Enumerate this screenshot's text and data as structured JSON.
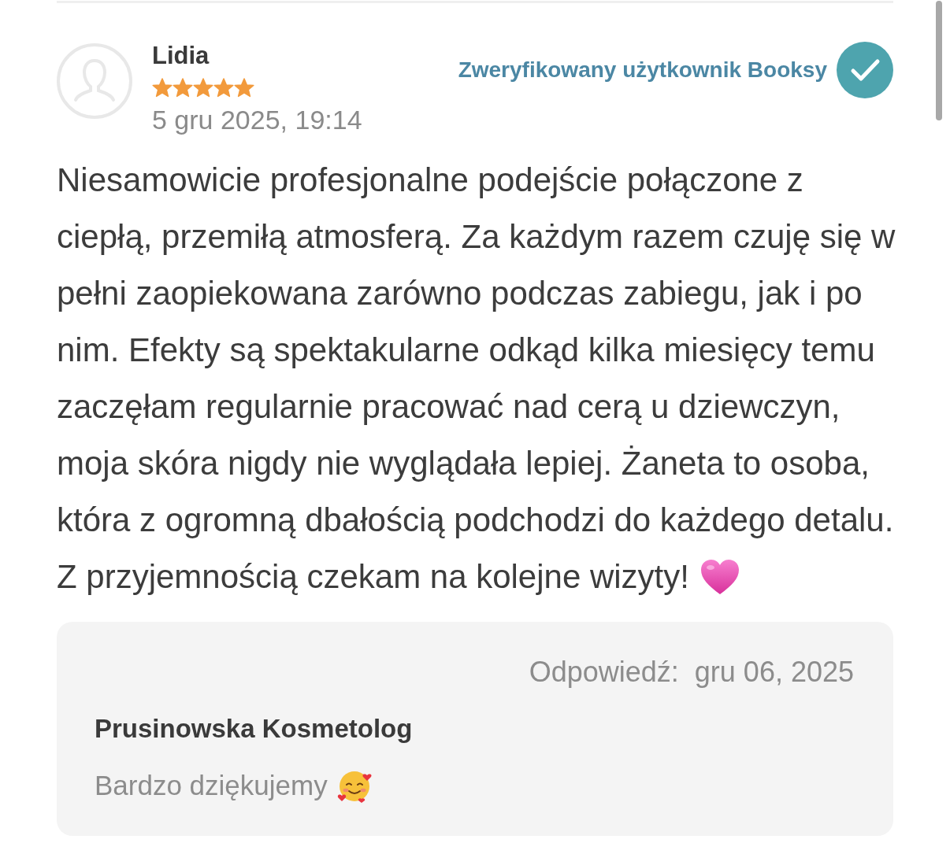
{
  "review": {
    "author": "Lidia",
    "stars": 5,
    "date": "5 gru 2025, 19:14",
    "verified": true,
    "verified_label": "Zweryfikowany użytkownik Booksy",
    "text": "Niesamowicie profesjonalne podejście połączone z ciepłą, przemiłą atmosferą. Za każdym razem czuję się w pełni zaopiekowana zarówno podczas zabiegu, jak i po nim. Efekty są spektakularne odkąd kilka miesięcy temu zaczęłam regularnie pracować nad cerą u dziewczyn, moja skóra nigdy nie wyglądała lepiej. Żaneta to osoba, która z ogromną dbałością podchodzi do każdego detalu.",
    "closing_text": "Z przyjemnością czekam na kolejne wizyty!"
  },
  "reply": {
    "label": "Odpowiedź:",
    "date": "gru 06, 2025",
    "author": "Prusinowska Kosmetolog",
    "text": "Bardzo dziękujemy"
  }
}
